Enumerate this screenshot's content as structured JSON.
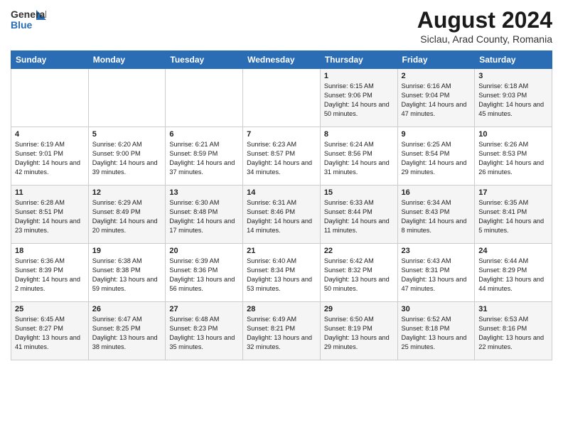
{
  "header": {
    "logo_general": "General",
    "logo_blue": "Blue",
    "month_title": "August 2024",
    "location": "Siclau, Arad County, Romania"
  },
  "days_of_week": [
    "Sunday",
    "Monday",
    "Tuesday",
    "Wednesday",
    "Thursday",
    "Friday",
    "Saturday"
  ],
  "weeks": [
    [
      {
        "day": "",
        "content": ""
      },
      {
        "day": "",
        "content": ""
      },
      {
        "day": "",
        "content": ""
      },
      {
        "day": "",
        "content": ""
      },
      {
        "day": "1",
        "content": "Sunrise: 6:15 AM\nSunset: 9:06 PM\nDaylight: 14 hours and 50 minutes."
      },
      {
        "day": "2",
        "content": "Sunrise: 6:16 AM\nSunset: 9:04 PM\nDaylight: 14 hours and 47 minutes."
      },
      {
        "day": "3",
        "content": "Sunrise: 6:18 AM\nSunset: 9:03 PM\nDaylight: 14 hours and 45 minutes."
      }
    ],
    [
      {
        "day": "4",
        "content": "Sunrise: 6:19 AM\nSunset: 9:01 PM\nDaylight: 14 hours and 42 minutes."
      },
      {
        "day": "5",
        "content": "Sunrise: 6:20 AM\nSunset: 9:00 PM\nDaylight: 14 hours and 39 minutes."
      },
      {
        "day": "6",
        "content": "Sunrise: 6:21 AM\nSunset: 8:59 PM\nDaylight: 14 hours and 37 minutes."
      },
      {
        "day": "7",
        "content": "Sunrise: 6:23 AM\nSunset: 8:57 PM\nDaylight: 14 hours and 34 minutes."
      },
      {
        "day": "8",
        "content": "Sunrise: 6:24 AM\nSunset: 8:56 PM\nDaylight: 14 hours and 31 minutes."
      },
      {
        "day": "9",
        "content": "Sunrise: 6:25 AM\nSunset: 8:54 PM\nDaylight: 14 hours and 29 minutes."
      },
      {
        "day": "10",
        "content": "Sunrise: 6:26 AM\nSunset: 8:53 PM\nDaylight: 14 hours and 26 minutes."
      }
    ],
    [
      {
        "day": "11",
        "content": "Sunrise: 6:28 AM\nSunset: 8:51 PM\nDaylight: 14 hours and 23 minutes."
      },
      {
        "day": "12",
        "content": "Sunrise: 6:29 AM\nSunset: 8:49 PM\nDaylight: 14 hours and 20 minutes."
      },
      {
        "day": "13",
        "content": "Sunrise: 6:30 AM\nSunset: 8:48 PM\nDaylight: 14 hours and 17 minutes."
      },
      {
        "day": "14",
        "content": "Sunrise: 6:31 AM\nSunset: 8:46 PM\nDaylight: 14 hours and 14 minutes."
      },
      {
        "day": "15",
        "content": "Sunrise: 6:33 AM\nSunset: 8:44 PM\nDaylight: 14 hours and 11 minutes."
      },
      {
        "day": "16",
        "content": "Sunrise: 6:34 AM\nSunset: 8:43 PM\nDaylight: 14 hours and 8 minutes."
      },
      {
        "day": "17",
        "content": "Sunrise: 6:35 AM\nSunset: 8:41 PM\nDaylight: 14 hours and 5 minutes."
      }
    ],
    [
      {
        "day": "18",
        "content": "Sunrise: 6:36 AM\nSunset: 8:39 PM\nDaylight: 14 hours and 2 minutes."
      },
      {
        "day": "19",
        "content": "Sunrise: 6:38 AM\nSunset: 8:38 PM\nDaylight: 13 hours and 59 minutes."
      },
      {
        "day": "20",
        "content": "Sunrise: 6:39 AM\nSunset: 8:36 PM\nDaylight: 13 hours and 56 minutes."
      },
      {
        "day": "21",
        "content": "Sunrise: 6:40 AM\nSunset: 8:34 PM\nDaylight: 13 hours and 53 minutes."
      },
      {
        "day": "22",
        "content": "Sunrise: 6:42 AM\nSunset: 8:32 PM\nDaylight: 13 hours and 50 minutes."
      },
      {
        "day": "23",
        "content": "Sunrise: 6:43 AM\nSunset: 8:31 PM\nDaylight: 13 hours and 47 minutes."
      },
      {
        "day": "24",
        "content": "Sunrise: 6:44 AM\nSunset: 8:29 PM\nDaylight: 13 hours and 44 minutes."
      }
    ],
    [
      {
        "day": "25",
        "content": "Sunrise: 6:45 AM\nSunset: 8:27 PM\nDaylight: 13 hours and 41 minutes."
      },
      {
        "day": "26",
        "content": "Sunrise: 6:47 AM\nSunset: 8:25 PM\nDaylight: 13 hours and 38 minutes."
      },
      {
        "day": "27",
        "content": "Sunrise: 6:48 AM\nSunset: 8:23 PM\nDaylight: 13 hours and 35 minutes."
      },
      {
        "day": "28",
        "content": "Sunrise: 6:49 AM\nSunset: 8:21 PM\nDaylight: 13 hours and 32 minutes."
      },
      {
        "day": "29",
        "content": "Sunrise: 6:50 AM\nSunset: 8:19 PM\nDaylight: 13 hours and 29 minutes."
      },
      {
        "day": "30",
        "content": "Sunrise: 6:52 AM\nSunset: 8:18 PM\nDaylight: 13 hours and 25 minutes."
      },
      {
        "day": "31",
        "content": "Sunrise: 6:53 AM\nSunset: 8:16 PM\nDaylight: 13 hours and 22 minutes."
      }
    ]
  ]
}
